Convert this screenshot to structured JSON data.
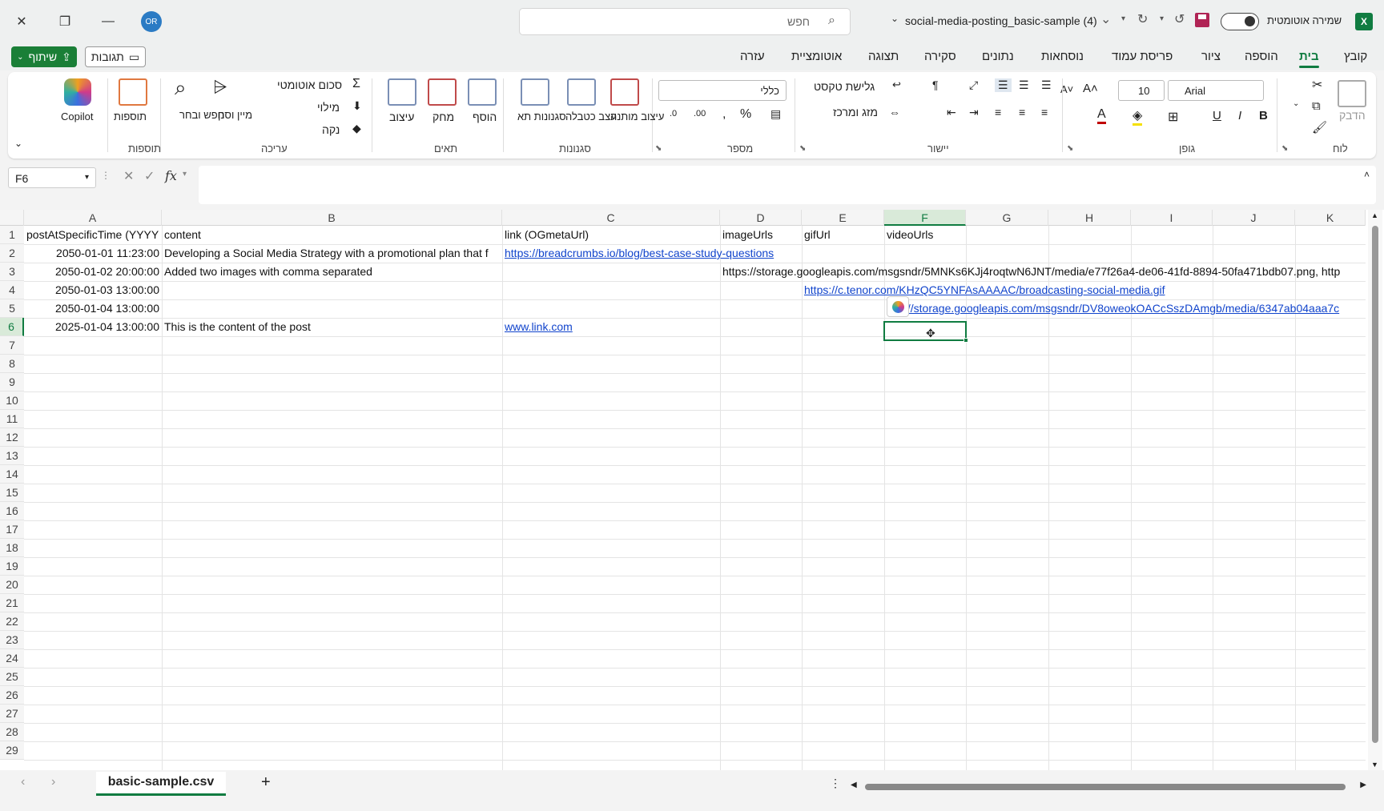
{
  "window": {
    "title": "social-media-posting_basic-sample (4)",
    "search_placeholder": "חפש",
    "autosave_label": "שמירה אוטומטית",
    "avatar_initials": "OR",
    "app_icon_letter": "X"
  },
  "header_buttons": {
    "share": "שיתוף",
    "comments": "תגובות"
  },
  "ribbon_tabs": [
    "קובץ",
    "בית",
    "הוספה",
    "ציור",
    "פריסת עמוד",
    "נוסחאות",
    "נתונים",
    "סקירה",
    "תצוגה",
    "אוטומציית",
    "עזרה"
  ],
  "active_tab": "בית",
  "ribbon": {
    "groups": {
      "clipboard": "לוח",
      "font": "גופן",
      "alignment": "יישור",
      "number": "מספר",
      "styles": "סגנונות",
      "cells": "תאים",
      "editing": "עריכה",
      "addins": "תוספות"
    },
    "paste": "הדבק",
    "font_name": "Arial",
    "font_size": "10",
    "wrap_text": "גלישת טקסט",
    "merge_center": "מזג ומרכז",
    "number_format": "כללי",
    "conditional_formatting": "עיצוב מותנה",
    "format_as_table": "עצב כטבלה",
    "cell_styles": "סגנונות תא",
    "insert": "הוסף",
    "delete": "מחק",
    "format": "עיצוב",
    "autosum": "סכום אוטומטי",
    "fill": "מילוי",
    "clear": "נקה",
    "sort_filter": "מיין וסנן",
    "find_select": "חפש ובחר",
    "addins": "תוספות",
    "copilot": "Copilot",
    "bold": "B",
    "italic": "I",
    "underline": "U"
  },
  "formula_bar": {
    "name_box": "F6",
    "fx": "fx",
    "formula": ""
  },
  "columns": [
    "A",
    "B",
    "C",
    "D",
    "E",
    "F",
    "G",
    "H",
    "I",
    "J",
    "K"
  ],
  "selected_column": "F",
  "rows": [
    "1",
    "2",
    "3",
    "4",
    "5",
    "6",
    "7",
    "8",
    "9",
    "10",
    "11",
    "12",
    "13",
    "14",
    "15",
    "16",
    "17",
    "18",
    "19",
    "20",
    "21",
    "22",
    "23",
    "24",
    "25",
    "26",
    "27",
    "28",
    "29"
  ],
  "selected_row": "6",
  "cells": {
    "A1": "postAtSpecificTime (YYYY",
    "B1": "content",
    "C1": "link (OGmetaUrl)",
    "D1": "imageUrls",
    "E1": "gifUrl",
    "F1": "videoUrls",
    "A2": "2050-01-01 11:23:00",
    "B2": "Developing a Social Media Strategy with a promotional plan that f",
    "C2": "https://breadcrumbs.io/blog/best-case-study-questions",
    "A3": "2050-01-02 20:00:00",
    "B3": "Added two images with comma separated",
    "D3": "https://storage.googleapis.com/msgsndr/5MNKs6KJj4roqtwN6JNT/media/e77f26a4-de06-41fd-8894-50fa471bdb07.png, http",
    "A4": "2050-01-03 13:00:00",
    "E4": "https://c.tenor.com/KHzQC5YNFAsAAAAC/broadcasting-social-media.gif",
    "A5": "2050-01-04 13:00:00",
    "F5": "://storage.googleapis.com/msgsndr/DV8oweokOACcSszDAmgb/media/6347ab04aaa7c",
    "A6": "2025-01-04 13:00:00",
    "B6": "This is the content of the post",
    "C6": "www.link.com"
  },
  "sheet": {
    "name": "basic-sample.csv",
    "add": "+"
  },
  "colors": {
    "accent": "#107c41",
    "link": "#1144cc",
    "avatar": "#2b7bc4",
    "save": "#b02455"
  }
}
